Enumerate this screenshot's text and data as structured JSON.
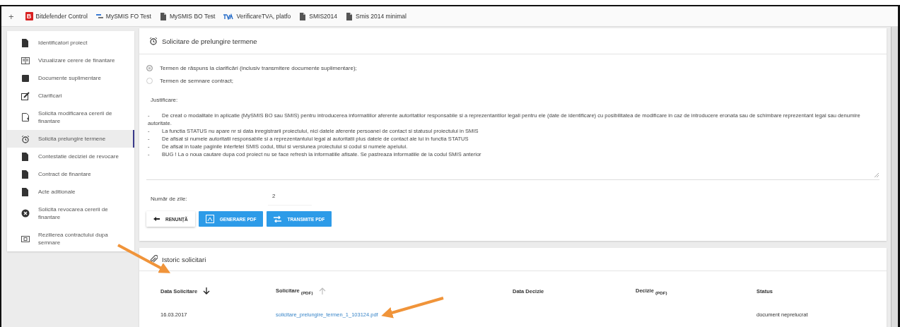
{
  "bookmarks": [
    {
      "kind": "plus",
      "label": "+"
    },
    {
      "kind": "letter",
      "mark": "B",
      "label": "Bitdefender Control"
    },
    {
      "kind": "mysmis",
      "label": "MySMIS FO Test"
    },
    {
      "kind": "doc",
      "label": "MySMIS BO Test"
    },
    {
      "kind": "tva",
      "label": "VerificareTVA, platfo"
    },
    {
      "kind": "doc",
      "label": "SMIS2014"
    },
    {
      "kind": "doc",
      "label": "Smis 2014  minimal"
    }
  ],
  "sidebar": {
    "items": [
      {
        "label": "Identificatori proiect",
        "selected": false
      },
      {
        "label": "Vizualizare cerere de finantare",
        "selected": false
      },
      {
        "label": "Documente suplimentare",
        "selected": false
      },
      {
        "label": "Clarificari",
        "selected": false
      },
      {
        "label": "Solicita modificarea cererii de finantare",
        "selected": false
      },
      {
        "label": "Solicita prelungire termene",
        "selected": true
      },
      {
        "label": "Contestatie deciziei de revocare",
        "selected": false
      },
      {
        "label": "Contract de finantare",
        "selected": false
      },
      {
        "label": "Acte aditionale",
        "selected": false
      },
      {
        "label": "Solicita revocarea cererii de finantare",
        "selected": false
      },
      {
        "label": "Rezilierea contractului dupa semnare",
        "selected": false
      }
    ]
  },
  "request": {
    "title": "Solicitare de prelungire termene",
    "options": [
      {
        "label": "Termen de răspuns la clarificări (inclusiv transmitere documente suplimentare);",
        "selected": true
      },
      {
        "label": "Termen de semnare contract;",
        "selected": false
      }
    ],
    "justification_label": "Justificare:",
    "justification_lines": [
      {
        "bullet": "-",
        "text": "De creat o modalitate in aplicatie (MySMIS BO sau SMIS) pentru introducerea informatiilor aferente autoritatilor responsabile si a reprezentantilor legali pentru ele (date de identificare) cu posibilitatea de modificare in caz de introducere eronata sau de schimbare reprezentant legal sau denumire autoritate."
      },
      {
        "bullet": "-",
        "text": "La functia STATUS nu apare nr si data inregistrarii proiectului, nici datele aferente persoanei de contact si statusul proiectului in SMIS"
      },
      {
        "bullet": "-",
        "text": "De afisat si numele autoritatii responsabile si a reprezentantului legal al autoritatii plus datele de contact ale lui in functia STATUS"
      },
      {
        "bullet": "-",
        "text": "De afisat in toate paginile interfetei SMIS codul, titlul si versiunea proiectului si codul si numele apelului."
      },
      {
        "bullet": "-",
        "text": "BUG ! La o noua cautare dupa cod proiect nu se face refresh la informatiile afisate. Se pastreaza informatiile de la codul SMIS anterior"
      }
    ],
    "days_label": "Număr de zile:",
    "days_value": "2",
    "buttons": [
      {
        "kind": "back",
        "label": "RENUNȚĂ"
      },
      {
        "kind": "pdf",
        "label": "GENERARE PDF"
      },
      {
        "kind": "transfer",
        "label": "TRANSMITE PDF"
      }
    ]
  },
  "history": {
    "title": "Istoric solicitari",
    "columns": [
      {
        "label": "Data Solicitare",
        "kind": "sorted_desc"
      },
      {
        "label": "Solicitare $_{(PDF)}$",
        "kind": "sortable"
      },
      {
        "label": "Data Decizie",
        "kind": "plain"
      },
      {
        "label": "Decizie $_{(PDF)}$",
        "kind": "plain"
      },
      {
        "label": "Status",
        "kind": "plain"
      }
    ],
    "rows": [
      {
        "cells": [
          {
            "kind": "text",
            "text": "16.03.2017"
          },
          {
            "kind": "link",
            "text": "solicitare_prelungire_termen_1_103124.pdf"
          },
          {
            "kind": "empty"
          },
          {
            "kind": "empty"
          },
          {
            "kind": "text",
            "text": "document neprelucrat"
          }
        ]
      }
    ]
  }
}
